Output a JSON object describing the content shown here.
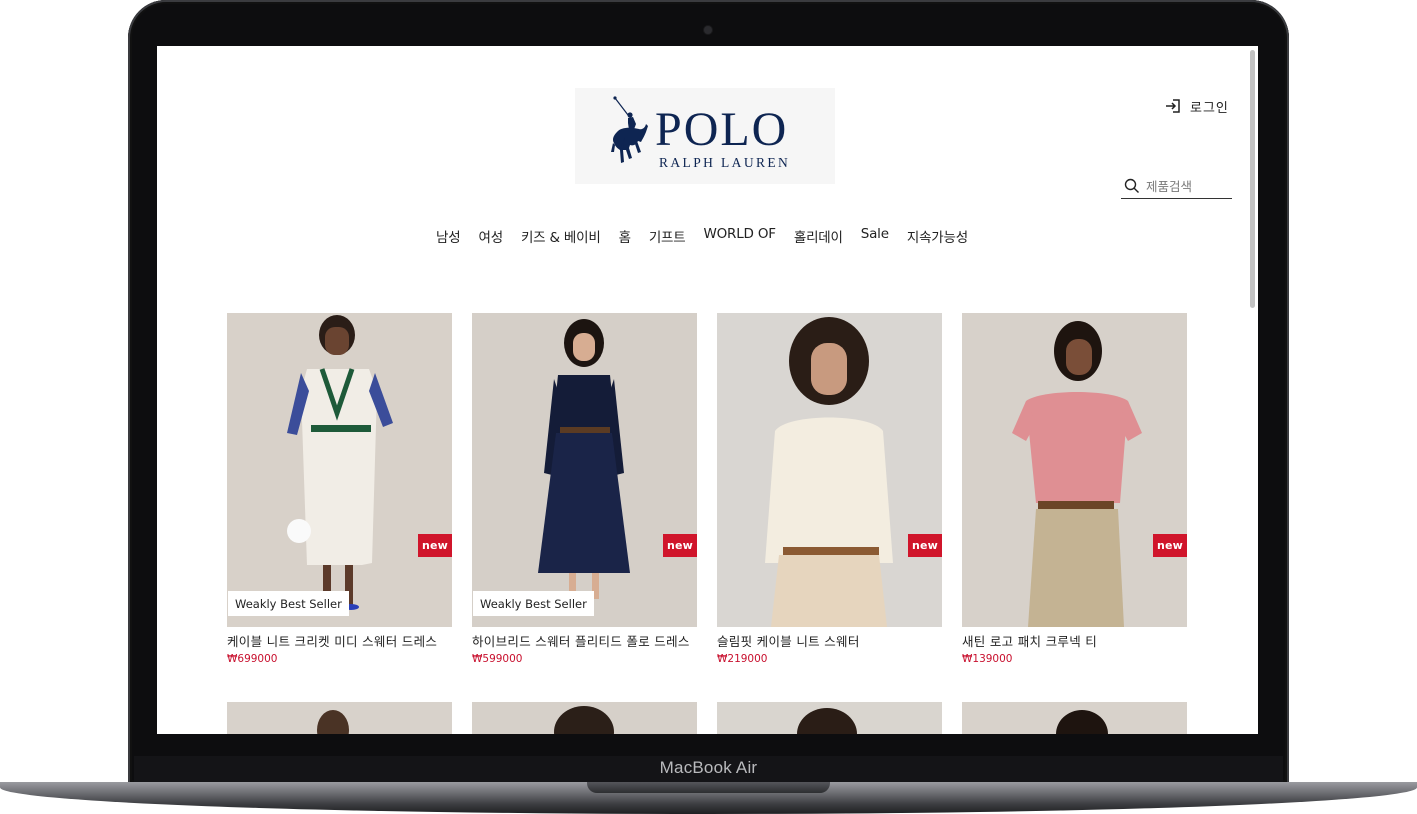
{
  "device": {
    "label": "MacBook Air"
  },
  "brand": {
    "logo_title": "POLO",
    "logo_subtitle": "RALPH LAUREN"
  },
  "header": {
    "login_label": "로그인",
    "search_placeholder": "제품검색"
  },
  "nav": {
    "items": [
      "남성",
      "여성",
      "키즈 & 베이비",
      "홈",
      "기프트",
      "WORLD OF",
      "홀리데이",
      "Sale",
      "지속가능성"
    ]
  },
  "products": [
    {
      "name": "케이블 니트 크리켓 미디 스웨터 드레스",
      "price": "₩699000",
      "new_label": "new",
      "best_label": "Weakly Best Seller",
      "icon": "model-photo-cricket-dress"
    },
    {
      "name": "하이브리드 스웨터 플리티드 폴로 드레스",
      "price": "₩599000",
      "new_label": "new",
      "best_label": "Weakly Best Seller",
      "icon": "model-photo-pleated-polo-dress"
    },
    {
      "name": "슬림핏 케이블 니트 스웨터",
      "price": "₩219000",
      "new_label": "new",
      "best_label": "",
      "icon": "model-photo-cable-knit-sweater"
    },
    {
      "name": "새틴 로고 패치 크루넥 티",
      "price": "₩139000",
      "new_label": "new",
      "best_label": "",
      "icon": "model-photo-logo-tee"
    }
  ],
  "colors": {
    "brand_navy": "#0e2552",
    "new_badge": "#d0152b",
    "price": "#c8102e",
    "photo_bg": "#d8d2cb"
  }
}
